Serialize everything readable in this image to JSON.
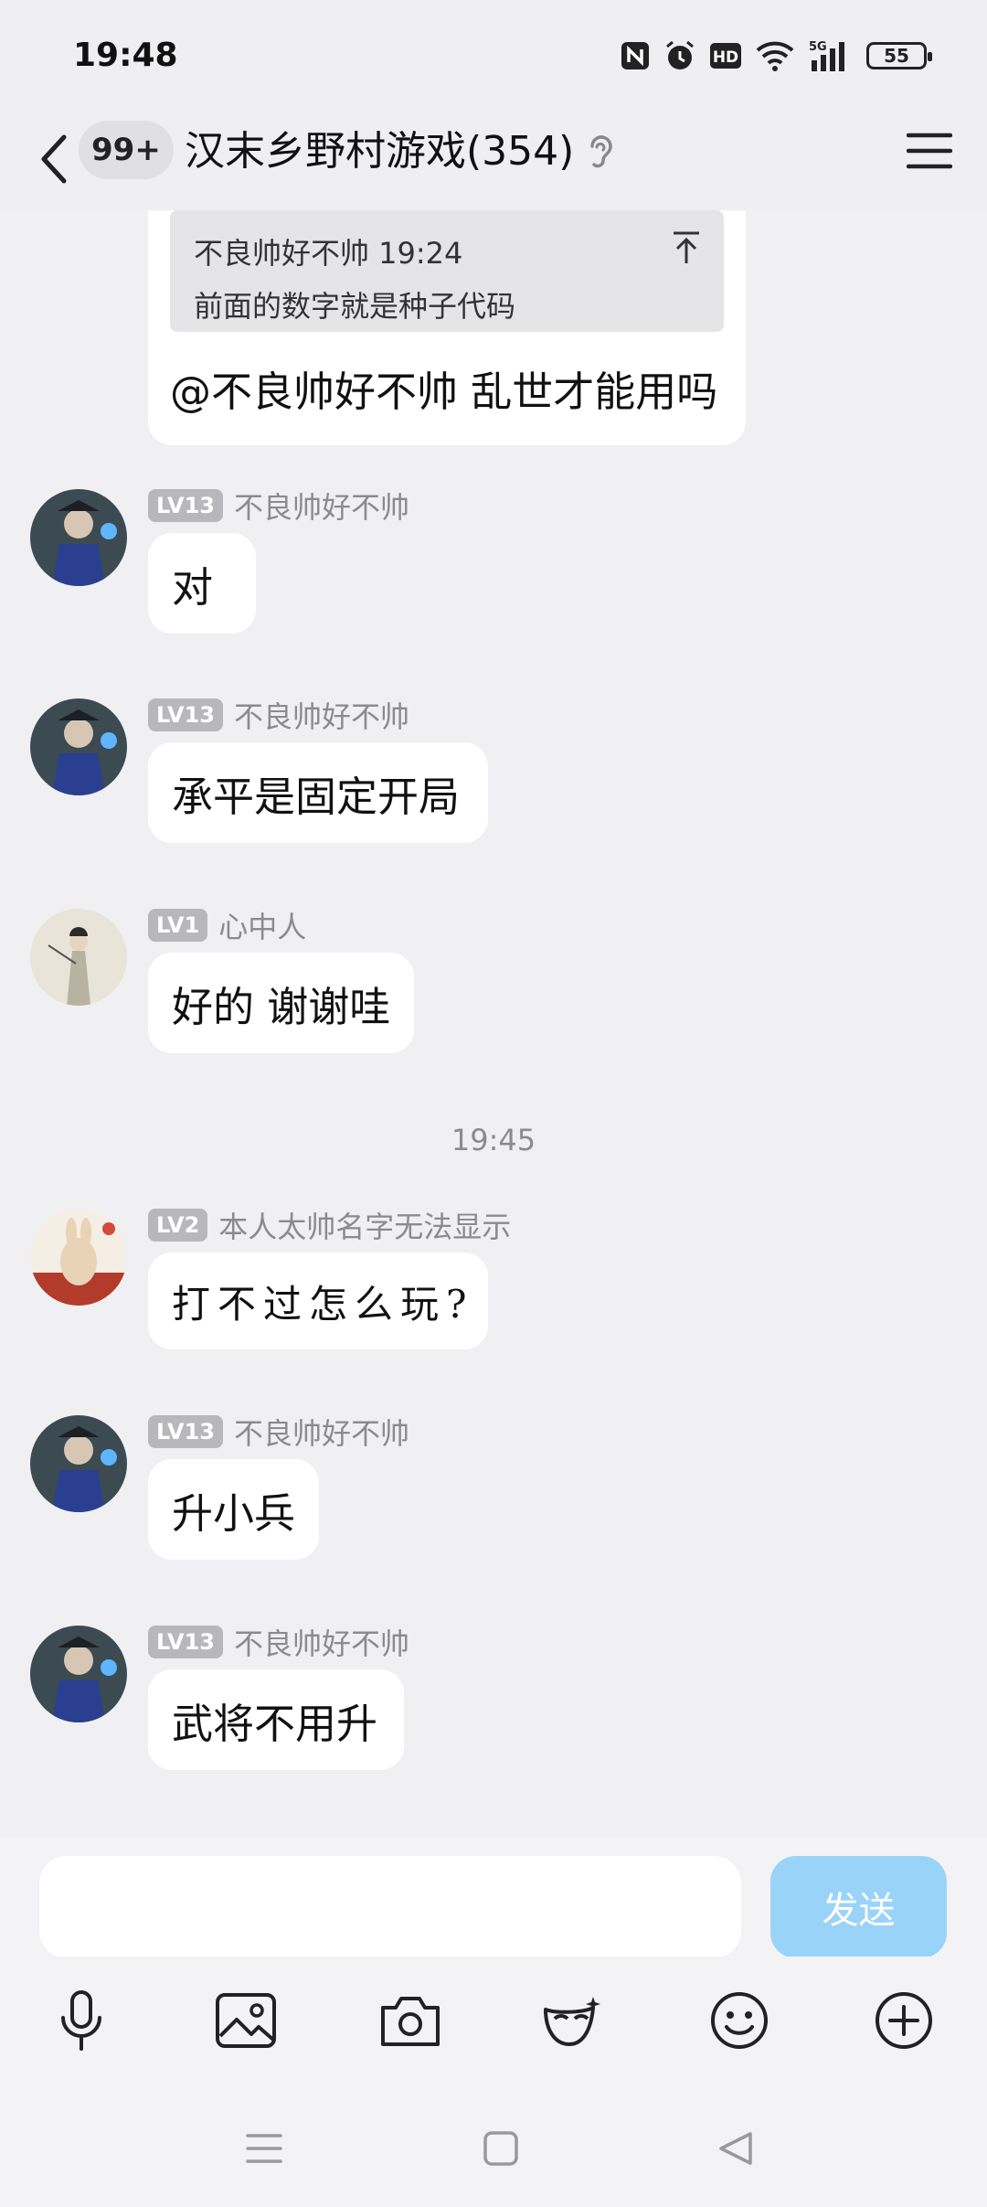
{
  "status_bar": {
    "time": "19:48",
    "icons": [
      "nfc-icon",
      "alarm-icon",
      "hd-icon",
      "wifi-icon",
      "5g-signal-icon"
    ],
    "network_label": "5G",
    "battery": "55"
  },
  "header": {
    "unread_count": "99+",
    "title": "汉末乡野村游戏(354)",
    "icons": [
      "back-icon",
      "ear-icon",
      "menu-icon"
    ]
  },
  "quoted_message": {
    "quote_author_time": "不良帅好不帅 19:24",
    "quote_text": "前面的数字就是种子代码",
    "reply_text": "@不良帅好不帅 乱世才能用吗"
  },
  "messages": [
    {
      "level": "LV13",
      "name": "不良帅好不帅",
      "text": "对"
    },
    {
      "level": "LV13",
      "name": "不良帅好不帅",
      "text": "承平是固定开局"
    },
    {
      "level": "LV1",
      "name": "心中人",
      "text": "好的 谢谢哇"
    },
    {
      "level": "LV2",
      "name": "本人太帅名字无法显示",
      "text": "打不过怎么玩?"
    },
    {
      "level": "LV13",
      "name": "不良帅好不帅",
      "text": "升小兵"
    },
    {
      "level": "LV13",
      "name": "不良帅好不帅",
      "text": "武将不用升"
    }
  ],
  "timestamp": "19:45",
  "input": {
    "value": "",
    "placeholder": "",
    "send_label": "发送"
  },
  "toolbar": [
    "microphone-icon",
    "image-icon",
    "camera-icon",
    "mask-icon",
    "emoji-icon",
    "plus-icon"
  ],
  "colors": {
    "background": "#f0f0f3",
    "bubble": "#ffffff",
    "send_button": "#9ad3f8",
    "level_badge": "#b7b7bc"
  }
}
